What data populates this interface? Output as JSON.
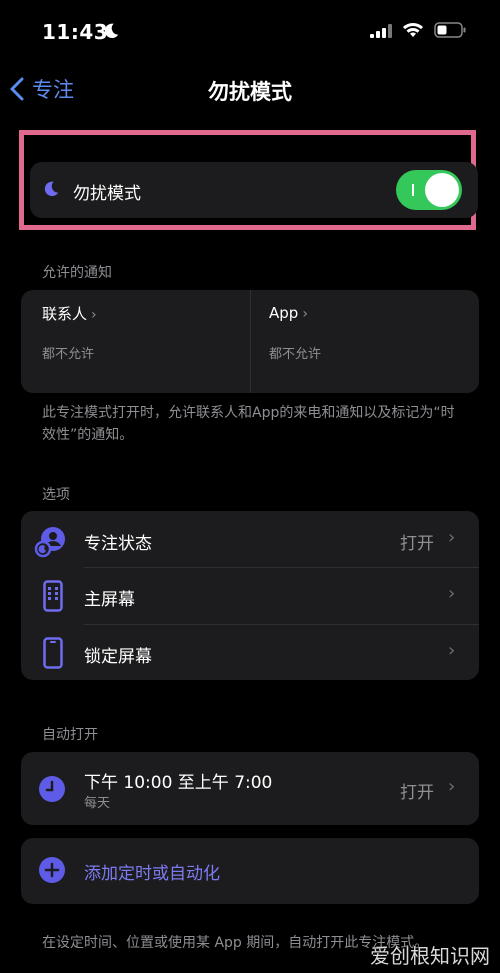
{
  "status": {
    "time": "11:43"
  },
  "nav": {
    "back_label": "专注",
    "title": "勿扰模式"
  },
  "dnd": {
    "label": "勿扰模式",
    "enabled": true
  },
  "allowed": {
    "header": "允许的通知",
    "contacts": {
      "title": "联系人",
      "value": "都不允许"
    },
    "apps": {
      "title": "App",
      "value": "都不允许"
    },
    "description": "此专注模式打开时，允许联系人和App的来电和通知以及标记为“时效性”的通知。"
  },
  "options": {
    "header": "选项",
    "items": [
      {
        "label": "专注状态",
        "value": "打开"
      },
      {
        "label": "主屏幕",
        "value": ""
      },
      {
        "label": "锁定屏幕",
        "value": ""
      }
    ]
  },
  "auto": {
    "header": "自动打开",
    "schedule": {
      "time": "下午 10:00 至上午 7:00",
      "repeat": "每天",
      "value": "打开"
    },
    "add_label": "添加定时或自动化",
    "footer": "在设定时间、位置或使用某 App 期间，自动打开此专注模式。"
  },
  "watermark": "爱创根知识网",
  "colors": {
    "accent": "#5b8cf0",
    "toggle_on": "#34c759",
    "highlight": "#e06a8e",
    "icon_purple": "#5e5ce6"
  }
}
